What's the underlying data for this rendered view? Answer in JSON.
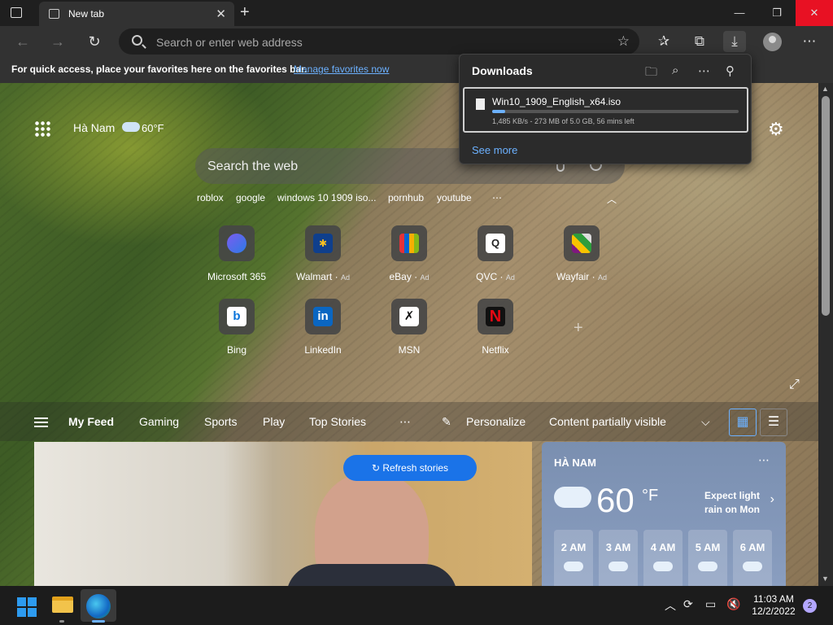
{
  "browser": {
    "tab_title": "New tab",
    "address_placeholder": "Search or enter web address",
    "favorites_message": "For quick access, place your favorites here on the favorites bar.",
    "favorites_link": "Manage favorites now"
  },
  "newtab": {
    "location": "Hà Nam",
    "temp": "60°F",
    "search_placeholder": "Search the web",
    "suggestions": [
      "roblox",
      "google",
      "windows 10 1909 iso...",
      "pornhub",
      "youtube"
    ],
    "tiles": [
      {
        "label": "Microsoft 365",
        "ad": ""
      },
      {
        "label": "Walmart",
        "ad": "Ad"
      },
      {
        "label": "eBay",
        "ad": "Ad"
      },
      {
        "label": "QVC",
        "ad": "Ad"
      },
      {
        "label": "Wayfair",
        "ad": "Ad"
      },
      {
        "label": "Bing",
        "ad": ""
      },
      {
        "label": "LinkedIn",
        "ad": ""
      },
      {
        "label": "MSN",
        "ad": ""
      },
      {
        "label": "Netflix",
        "ad": ""
      }
    ]
  },
  "feed": {
    "tabs": [
      "My Feed",
      "Gaming",
      "Sports",
      "Play",
      "Top Stories"
    ],
    "personalize": "Personalize",
    "visibility": "Content partially visible",
    "refresh": "Refresh stories"
  },
  "weather": {
    "location": "HÀ NAM",
    "temp": "60",
    "unit": "°F",
    "forecast": "Expect light rain on Mon",
    "hours": [
      "2 AM",
      "3 AM",
      "4 AM",
      "5 AM",
      "6 AM"
    ]
  },
  "downloads": {
    "title": "Downloads",
    "filename": "Win10_1909_English_x64.iso",
    "status": "1,485 KB/s - 273 MB of 5.0 GB, 56 mins left",
    "progress": 0.053,
    "see_more": "See more"
  },
  "taskbar": {
    "time": "11:03 AM",
    "date": "12/2/2022",
    "notification_count": "2"
  },
  "colors": {
    "accent": "#6cb1ff",
    "refresh_button": "#1a73e8",
    "close_button": "#e81123"
  }
}
